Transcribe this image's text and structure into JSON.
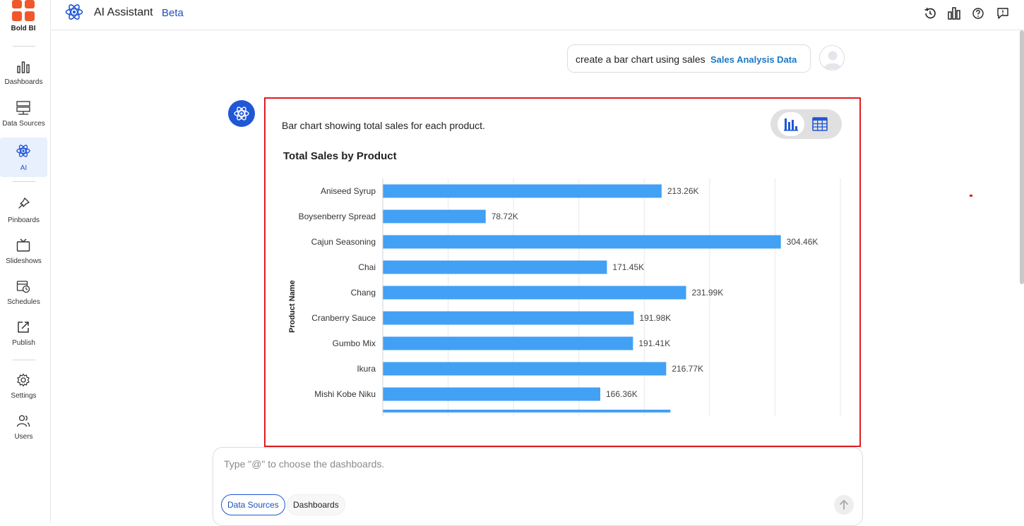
{
  "sidebar": {
    "logo_text": "Bold BI",
    "items": [
      {
        "label": "Dashboards",
        "icon": "dashboards-icon"
      },
      {
        "label": "Data Sources",
        "icon": "data-sources-icon"
      },
      {
        "label": "AI",
        "icon": "ai-icon",
        "active": true
      },
      {
        "label": "Pinboards",
        "icon": "pin-icon"
      },
      {
        "label": "Slideshows",
        "icon": "slideshow-icon"
      },
      {
        "label": "Schedules",
        "icon": "schedule-icon"
      },
      {
        "label": "Publish",
        "icon": "publish-icon"
      },
      {
        "label": "Settings",
        "icon": "gear-icon"
      },
      {
        "label": "Users",
        "icon": "users-icon"
      }
    ]
  },
  "header": {
    "title": "AI Assistant",
    "badge": "Beta",
    "actions": [
      "history-icon",
      "chart-icon",
      "help-icon",
      "feedback-icon"
    ]
  },
  "chat": {
    "user_message": "create a bar chart using sales",
    "user_message_link": "Sales Analysis Data",
    "response_text": "Bar chart showing total sales for each product.",
    "view_toggle": {
      "selected": "chart",
      "options": [
        "chart",
        "table"
      ]
    }
  },
  "input": {
    "placeholder": "Type \"@\" to choose the dashboards.",
    "chips": [
      "Data Sources",
      "Dashboards"
    ]
  },
  "colors": {
    "accent": "#1f57d6",
    "bar": "#42a0f5",
    "highlight_border": "#e01b22"
  },
  "chart_data": {
    "type": "bar",
    "orientation": "horizontal",
    "title": "Total Sales by Product",
    "ylabel": "Product Name",
    "xlabel": "",
    "categories": [
      "Aniseed Syrup",
      "Boysenberry Spread",
      "Cajun Seasoning",
      "Chai",
      "Chang",
      "Cranberry Sauce",
      "Gumbo Mix",
      "Ikura",
      "Mishi Kobe Niku"
    ],
    "values": [
      213.26,
      78.72,
      304.46,
      171.45,
      231.99,
      191.98,
      191.41,
      216.77,
      166.36
    ],
    "value_labels": [
      "213.26K",
      "78.72K",
      "304.46K",
      "171.45K",
      "231.99K",
      "191.98K",
      "191.41K",
      "216.77K",
      "166.36K"
    ],
    "value_unit": "K",
    "xlim": [
      0,
      350
    ],
    "grid": true,
    "partially_visible_next_value": 220
  }
}
